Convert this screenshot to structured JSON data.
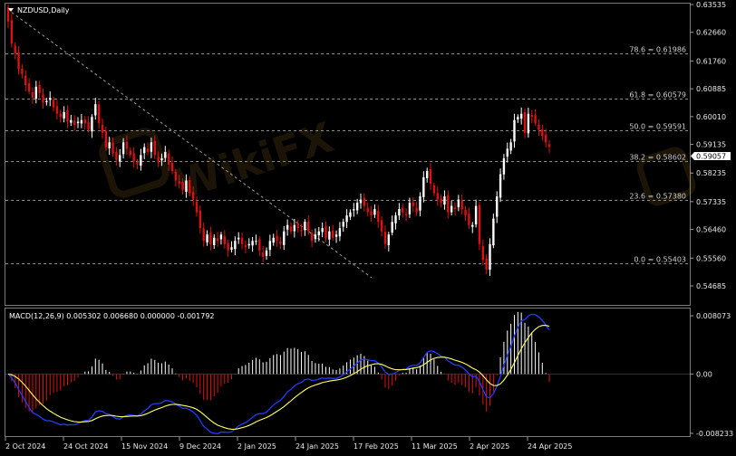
{
  "chart_data": [
    {
      "type": "candlestick",
      "title": "NZDUSD,Daily",
      "symbol": "NZDUSD",
      "timeframe": "Daily",
      "ylim": [
        0.54685,
        0.63535
      ],
      "price_ticks": [
        "0.63535",
        "0.62660",
        "0.61760",
        "0.60885",
        "0.60010",
        "0.59135",
        "0.58235",
        "0.57335",
        "0.56460",
        "0.55560",
        "0.54685"
      ],
      "current_price": "0.59057",
      "fibonacci": [
        {
          "label": "78.6 = 0.61986",
          "value": 0.61986
        },
        {
          "label": "61.8 = 0.60579",
          "value": 0.60579
        },
        {
          "label": "50.0 = 0.59591",
          "value": 0.59591
        },
        {
          "label": "38.2 = 0.58602",
          "value": 0.58602
        },
        {
          "label": "23.6 = 0.57380",
          "value": 0.5738
        },
        {
          "label": "0.0 = 0.55403",
          "value": 0.55403
        }
      ],
      "x_labels": [
        "2 Oct 2024",
        "24 Oct 2024",
        "15 Nov 2024",
        "9 Dec 2024",
        "2 Jan 2025",
        "24 Jan 2025",
        "17 Feb 2025",
        "11 Mar 2025",
        "2 Apr 2025",
        "24 Apr 2025"
      ],
      "close": [
        0.63,
        0.623,
        0.62,
        0.615,
        0.6135,
        0.61,
        0.608,
        0.606,
        0.6095,
        0.6075,
        0.6045,
        0.605,
        0.606,
        0.603,
        0.601,
        0.6,
        0.6015,
        0.5985,
        0.599,
        0.5975,
        0.5985,
        0.599,
        0.598,
        0.596,
        0.6,
        0.604,
        0.598,
        0.595,
        0.5905,
        0.592,
        0.5885,
        0.5865,
        0.588,
        0.592,
        0.59,
        0.588,
        0.586,
        0.585,
        0.588,
        0.5905,
        0.589,
        0.592,
        0.588,
        0.586,
        0.587,
        0.589,
        0.585,
        0.583,
        0.58,
        0.579,
        0.577,
        0.58,
        0.576,
        0.574,
        0.57,
        0.565,
        0.561,
        0.563,
        0.56,
        0.562,
        0.561,
        0.563,
        0.56,
        0.558,
        0.559,
        0.561,
        0.562,
        0.56,
        0.559,
        0.56,
        0.561,
        0.561,
        0.558,
        0.556,
        0.558,
        0.561,
        0.562,
        0.561,
        0.56,
        0.564,
        0.566,
        0.564,
        0.566,
        0.565,
        0.564,
        0.567,
        0.564,
        0.561,
        0.563,
        0.564,
        0.565,
        0.562,
        0.564,
        0.562,
        0.563,
        0.565,
        0.567,
        0.569,
        0.57,
        0.571,
        0.573,
        0.574,
        0.572,
        0.57,
        0.569,
        0.571,
        0.567,
        0.564,
        0.56,
        0.563,
        0.567,
        0.569,
        0.571,
        0.57,
        0.569,
        0.573,
        0.572,
        0.57,
        0.575,
        0.581,
        0.583,
        0.579,
        0.576,
        0.574,
        0.573,
        0.575,
        0.57,
        0.572,
        0.571,
        0.574,
        0.571,
        0.569,
        0.566,
        0.566,
        0.572,
        0.56,
        0.555,
        0.552,
        0.56,
        0.568,
        0.575,
        0.582,
        0.587,
        0.59,
        0.592,
        0.599,
        0.6,
        0.601,
        0.595,
        0.601,
        0.6,
        0.598,
        0.596,
        0.594,
        0.592,
        0.5906
      ],
      "macd": {
        "label": "MACD(12,26,9) 0.005302 0.006680 0.000000 -0.001792",
        "params": "12,26,9",
        "values": [
          "0.005302",
          "0.006680",
          "0.000000",
          "-0.001792"
        ],
        "ylim": [
          -0.008233,
          0.008073
        ],
        "ticks": [
          "0.008073",
          "0.00",
          "-0.008233"
        ]
      }
    }
  ]
}
